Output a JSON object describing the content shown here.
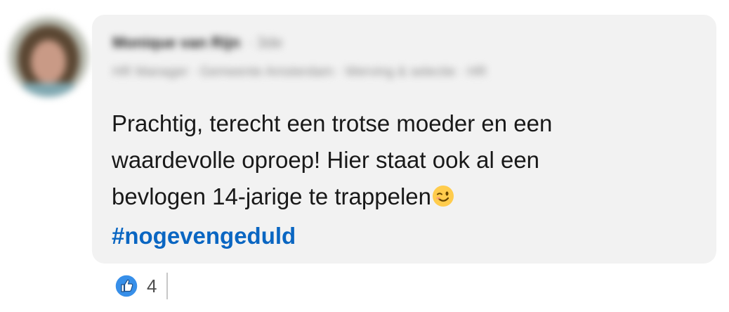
{
  "author": {
    "name": "Monique van Rijn",
    "degree": "· 3de",
    "headline": "HR Manager · Gemeente Amsterdam · Werving & selectie · HR"
  },
  "comment": {
    "lines": [
      "Prachtig, terecht een trotse moeder en een",
      "waardevolle oproep! Hier staat ook al een",
      "bevlogen 14-jarige te trappelen"
    ],
    "hashtag": "#nogevengeduld"
  },
  "reactions": {
    "icon": "like-icon",
    "count": "4"
  },
  "colors": {
    "bubble": "#f2f2f2",
    "hashtag": "#0a66c2",
    "like": "#378fe9"
  }
}
